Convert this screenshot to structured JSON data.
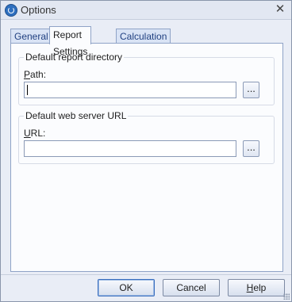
{
  "window": {
    "title": "Options"
  },
  "tabs": [
    {
      "label": "General",
      "active": false
    },
    {
      "label": "Report Settings",
      "active": true
    },
    {
      "label": "Calculation",
      "active": false
    }
  ],
  "report_settings": {
    "report_directory": {
      "legend": "Default report directory",
      "label_accel": "P",
      "label_rest": "ath:",
      "value": "",
      "browse_label": "..."
    },
    "web_server": {
      "legend": "Default web server URL",
      "label_accel": "U",
      "label_rest": "RL:",
      "value": "",
      "browse_label": "..."
    }
  },
  "buttons": {
    "ok": "OK",
    "cancel": "Cancel",
    "help_accel": "H",
    "help_rest": "elp"
  }
}
